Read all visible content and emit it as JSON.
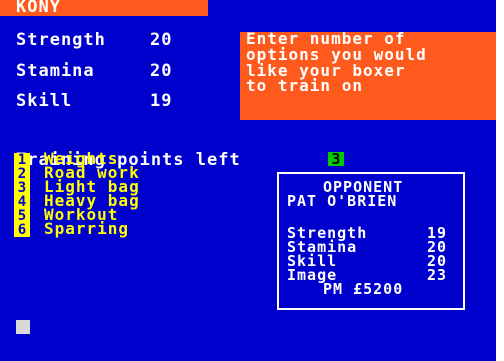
{
  "title": "KONY",
  "stats": [
    {
      "label": "Strength",
      "value": "20"
    },
    {
      "label": "Stamina",
      "value": "20"
    },
    {
      "label": "Skill",
      "value": "19"
    }
  ],
  "prompt_lines": [
    "Enter number of",
    "options you would",
    "like your boxer",
    "to train on"
  ],
  "training": {
    "label": "Training points left",
    "value": "3"
  },
  "menu": [
    {
      "num": "1",
      "label": "Weights"
    },
    {
      "num": "2",
      "label": "Road work"
    },
    {
      "num": "3",
      "label": "Light bag"
    },
    {
      "num": "4",
      "label": "Heavy bag"
    },
    {
      "num": "5",
      "label": "Workout"
    },
    {
      "num": "6",
      "label": "Sparring"
    }
  ],
  "opponent": {
    "heading": "OPPONENT",
    "name": "PAT O'BRIEN",
    "stats": [
      {
        "label": "Strength",
        "value": "19"
      },
      {
        "label": "Stamina",
        "value": "20"
      },
      {
        "label": "Skill",
        "value": "20"
      },
      {
        "label": "Image",
        "value": "23"
      }
    ],
    "purse": "PM £5200"
  },
  "colors": {
    "background": "#0000cc",
    "accent": "#ff5a1e",
    "menu": "#ffff00",
    "highlight": "#00cc00"
  }
}
